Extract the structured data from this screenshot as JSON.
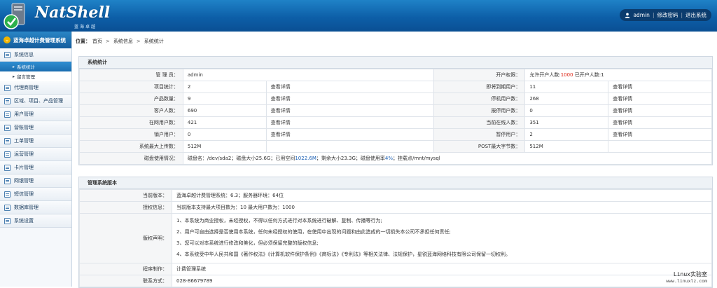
{
  "header": {
    "logo_text": "NatShell",
    "logo_sub": "蓝海卓越",
    "user": "admin",
    "change_pwd": "修改密码",
    "logout": "退出系统"
  },
  "sidebar": {
    "title": "蓝海卓越计费管理系统",
    "sections": [
      {
        "label": "系统信息",
        "subs": [
          {
            "label": "系统统计",
            "active": true
          },
          {
            "label": "留言管理",
            "active": false
          }
        ]
      },
      {
        "label": "代理商管理"
      },
      {
        "label": "区域、项目、产品管理"
      },
      {
        "label": "用户管理"
      },
      {
        "label": "营账管理"
      },
      {
        "label": "工单管理"
      },
      {
        "label": "运营管理"
      },
      {
        "label": "卡片管理"
      },
      {
        "label": "网银管理"
      },
      {
        "label": "短信管理"
      },
      {
        "label": "数据库管理"
      },
      {
        "label": "系统设置"
      }
    ]
  },
  "breadcrumb": {
    "prefix": "位置：",
    "items": [
      "首页",
      "系统信息",
      "系统统计"
    ]
  },
  "stats": {
    "title": "系统统计",
    "detail": "查看详情",
    "admin_label": "管 理 员：",
    "admin_value": "admin",
    "perm_label": "开户权限：",
    "perm_pre": "允许开户人数:",
    "perm_max": "1000",
    "perm_mid": "已开户人数:",
    "perm_used": "1",
    "rows": [
      {
        "l1": "项目统计：",
        "v1": "2",
        "l2": "即将到期用户：",
        "v2": "11"
      },
      {
        "l1": "产品数量：",
        "v1": "9",
        "l2": "停机用户数：",
        "v2": "268"
      },
      {
        "l1": "客户人数：",
        "v1": "690",
        "l2": "报停用户数：",
        "v2": "0"
      },
      {
        "l1": "在网用户数：",
        "v1": "421",
        "l2": "当前在线人数：",
        "v2": "351"
      },
      {
        "l1": "销户用户：",
        "v1": "0",
        "l2": "暂停用户：",
        "v2": "2"
      }
    ],
    "upload_label": "系统最大上传数：",
    "upload_value": "512M",
    "post_label": "POST最大字节数：",
    "post_value": "512M",
    "disk_label": "磁盘使用情况：",
    "disk_pre": "磁盘名：/dev/sda2；磁盘大小25.6G；已用空间",
    "disk_used": "1022.6M",
    "disk_mid": "；剩余大小23.3G；磁盘使用率",
    "disk_pct": "4%",
    "disk_post": "；挂载点/mnt/mysql"
  },
  "version": {
    "title": "管理系统版本",
    "cur_label": "当前版本：",
    "cur_value": "蓝海卓越计费管理系统：6.3；服务器环境：64位",
    "lic_label": "授权信息：",
    "lic_value": "当前版本支持最大项目数为：10  最大用户数为：1000",
    "decl_label": "版权声明：",
    "decl": [
      "1、本系统为商业授权，未经授权，不得以任何方式进行对本系统进行破解、复制、传播等行为;",
      "2、用户可自由选择是否使用本系统，任何未经授权的使用，在使用中出现的问题和由此造成的一切损失本公司不承担任何责任;",
      "3、您可以对本系统进行修改和美化，但必须保留完整的版权信息;",
      "4、本系统受中华人民共和国《著作权法》《计算机软件保护条例》《商标法》《专利法》等相关法律、法规保护，星锐蓝海网络科技有限公司保留一切权利。"
    ],
    "prog_label": "程序制作：",
    "prog_value": "计费管理系统",
    "contact_label": "联系方式：",
    "contact_value": "028-86679789"
  },
  "watermark": {
    "line1": "Linux实验室",
    "line2": "www.linuxlz.com"
  }
}
